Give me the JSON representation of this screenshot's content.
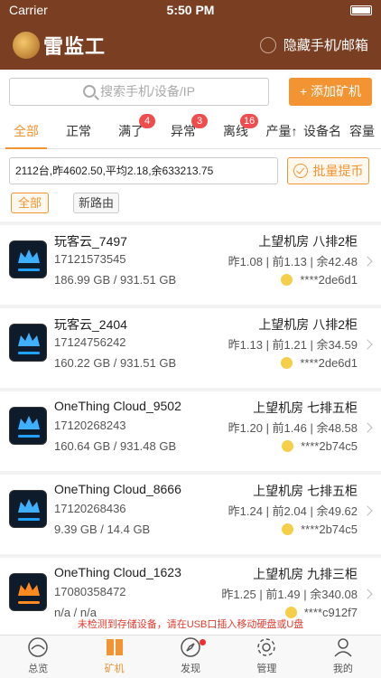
{
  "status_bar": {
    "carrier": "Carrier",
    "time": "5:50 PM"
  },
  "header": {
    "logo_text": "雷监工",
    "hide_label": "隐藏手机/邮箱"
  },
  "search": {
    "placeholder": "搜索手机/设备/IP",
    "add_button": "+ 添加矿机"
  },
  "tabs": [
    {
      "label": "全部",
      "badge": ""
    },
    {
      "label": "正常",
      "badge": ""
    },
    {
      "label": "满了",
      "badge": "4"
    },
    {
      "label": "异常",
      "badge": "3"
    },
    {
      "label": "离线",
      "badge": "16"
    },
    {
      "label": "产量↑",
      "badge": ""
    },
    {
      "label": "设备名",
      "badge": ""
    },
    {
      "label": "容量",
      "badge": ""
    }
  ],
  "summary": {
    "text": "2112台,昨4602.50,平均2.18,余633213.75",
    "withdraw_label": "批量提币"
  },
  "filters": {
    "all": "全部",
    "route": "新路由"
  },
  "devices": [
    {
      "name": "玩客云_7497",
      "phone": "17121573545",
      "storage": "186.99 GB / 931.51 GB",
      "room": "上望机房 八排2柜",
      "stats": "昨1.08 | 前1.13 | 余42.48",
      "account": "****2de6d1"
    },
    {
      "name": "玩客云_2404",
      "phone": "17124756242",
      "storage": "160.22 GB / 931.51 GB",
      "room": "上望机房 八排2柜",
      "stats": "昨1.13 | 前1.21 | 余34.59",
      "account": "****2de6d1"
    },
    {
      "name": "OneThing Cloud_9502",
      "phone": "17120268243",
      "storage": "160.64 GB / 931.48 GB",
      "room": "上望机房 七排五柜",
      "stats": "昨1.20 | 前1.46 | 余48.58",
      "account": "****2b74c5"
    },
    {
      "name": "OneThing Cloud_8666",
      "phone": "17120268436",
      "storage": "9.39 GB / 14.4 GB",
      "room": "上望机房 七排五柜",
      "stats": "昨1.24 | 前2.04 | 余49.62",
      "account": "****2b74c5"
    },
    {
      "name": "OneThing Cloud_1623",
      "phone": "17080358472",
      "storage": "n/a / n/a",
      "room": "上望机房 九排三柜",
      "stats": "昨1.25 | 前1.49 | 余340.08",
      "account": "****c912f7"
    }
  ],
  "warning": "未检测到存储设备，请在USB口插入移动硬盘或U盘",
  "tabbar": [
    {
      "label": "总览",
      "icon": "overview-icon"
    },
    {
      "label": "矿机",
      "icon": "miner-icon"
    },
    {
      "label": "发现",
      "icon": "compass-icon"
    },
    {
      "label": "管理",
      "icon": "gear-icon"
    },
    {
      "label": "我的",
      "icon": "person-icon"
    }
  ],
  "colors": {
    "brand_brown": "#7a3f23",
    "accent_orange": "#f29431",
    "badge_red": "#ef4d4d"
  }
}
